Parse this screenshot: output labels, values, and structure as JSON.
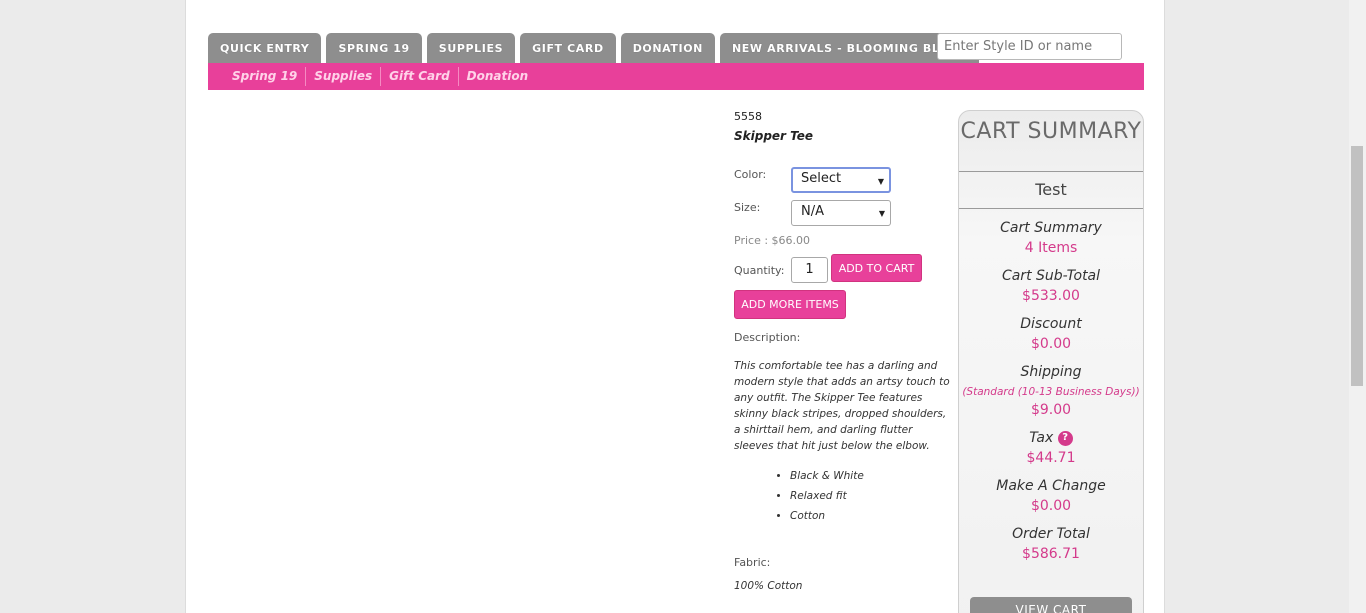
{
  "tabs": [
    "QUICK ENTRY",
    "SPRING 19",
    "SUPPLIES",
    "GIFT CARD",
    "DONATION",
    "NEW ARRIVALS - BLOOMING BLUSH"
  ],
  "search": {
    "placeholder": "Enter Style ID or name"
  },
  "subnav": [
    "Spring 19",
    "Supplies",
    "Gift Card",
    "Donation"
  ],
  "product": {
    "style_id": "5558",
    "name": "Skipper Tee",
    "color_label": "Color:",
    "color_value": "Select",
    "size_label": "Size:",
    "size_value": "N/A",
    "price": "Price : $66.00",
    "quantity_label": "Quantity:",
    "quantity_value": "1",
    "add_to_cart": "ADD TO CART",
    "add_more": "ADD MORE ITEMS",
    "description_label": "Description:",
    "description": "This comfortable tee has a darling and modern style that adds an artsy touch to any outfit. The Skipper Tee features skinny black stripes, dropped shoulders, a shirttail hem, and darling flutter sleeves that hit just below the elbow.",
    "bullets": [
      "Black & White",
      "Relaxed fit",
      "Cotton"
    ],
    "fabric_label": "Fabric:",
    "fabric_value": "100% Cotton"
  },
  "cart": {
    "title": "CART SUMMARY",
    "user": "Test",
    "summary_label": "Cart Summary",
    "items": "4 Items",
    "subtotal_label": "Cart Sub-Total",
    "subtotal": "$533.00",
    "discount_label": "Discount",
    "discount": "$0.00",
    "shipping_label": "Shipping",
    "shipping_note": "(Standard (10-13 Business Days))",
    "shipping": "$9.00",
    "tax_label": "Tax",
    "tax_icon": "?",
    "tax": "$44.71",
    "change_label": "Make A Change",
    "change": "$0.00",
    "total_label": "Order Total",
    "total": "$586.71",
    "view_cart": "VIEW CART"
  },
  "colors": {
    "accent": "#e8409a",
    "tab": "#8e8e8e"
  }
}
